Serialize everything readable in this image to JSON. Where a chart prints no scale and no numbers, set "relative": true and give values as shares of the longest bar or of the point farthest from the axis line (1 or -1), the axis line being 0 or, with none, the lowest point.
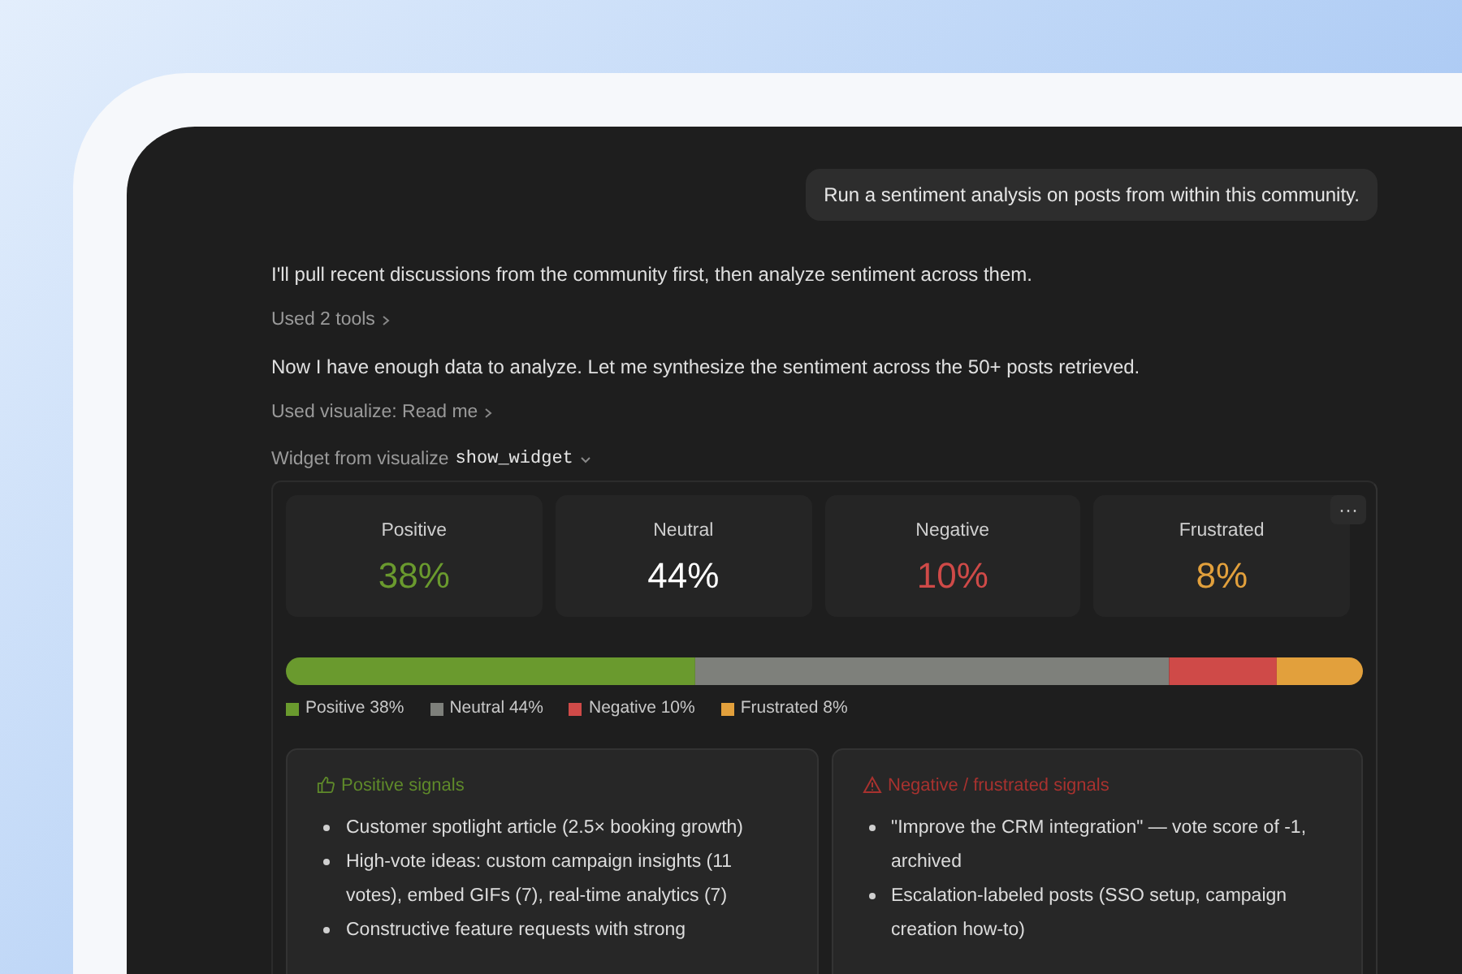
{
  "user_message": "Run a sentiment analysis on posts from within this community.",
  "assistant_lines": [
    {
      "kind": "text",
      "text": "I'll pull recent discussions from the community first, then analyze sentiment across them."
    },
    {
      "kind": "tool",
      "text": "Used 2 tools"
    },
    {
      "kind": "text",
      "text": "Now I have enough data to analyze. Let me synthesize the sentiment across the 50+ posts retrieved."
    },
    {
      "kind": "tool",
      "text": "Used visualize: Read me"
    }
  ],
  "widget_label": {
    "text": "Widget from visualize",
    "code": "show_widget"
  },
  "widget": {
    "menu": "···",
    "sentiments": [
      {
        "label": "Positive",
        "value": "38%",
        "kind": "colored"
      },
      {
        "label": "Neutral",
        "value": "44%",
        "kind": "plain"
      },
      {
        "label": "Negative",
        "value": "10%",
        "kind": "colored"
      },
      {
        "label": "Frustrated",
        "value": "8%",
        "kind": "colored"
      }
    ],
    "chart_data": {
      "type": "bar",
      "orientation": "horizontal",
      "stacked": true,
      "relative": true,
      "series": [
        {
          "color": "#6a9a2e",
          "values": [
            0.38
          ]
        },
        {
          "color": "#7e807b",
          "values": [
            0.44
          ]
        },
        {
          "color": "#cf4a48",
          "values": [
            0.1
          ]
        },
        {
          "color": "#e2a03c",
          "values": [
            0.08
          ]
        }
      ]
    },
    "legend": [
      {
        "text": "Positive 38%",
        "color": "#6a9a2e"
      },
      {
        "text": "Neutral 44%",
        "color": "#7e807b"
      },
      {
        "text": "Negative 10%",
        "color": "#cf4a48"
      },
      {
        "text": "Frustrated 8%",
        "color": "#e2a03c"
      }
    ],
    "signals": [
      {
        "kind": "positive",
        "title": "Positive signals",
        "color": "#5f8a2a",
        "items": [
          "Customer spotlight article (2.5× booking growth)",
          "High-vote ideas: custom campaign insights (11 votes), embed GIFs (7), real-time analytics (7)",
          "Constructive feature requests with strong"
        ]
      },
      {
        "kind": "negative",
        "title": "Negative / frustrated signals",
        "color": "#a8322f",
        "items": [
          "\"Improve the CRM integration\" — vote score of -1, archived",
          "Escalation-labeled posts (SSO setup, campaign creation how-to)"
        ]
      }
    ]
  }
}
